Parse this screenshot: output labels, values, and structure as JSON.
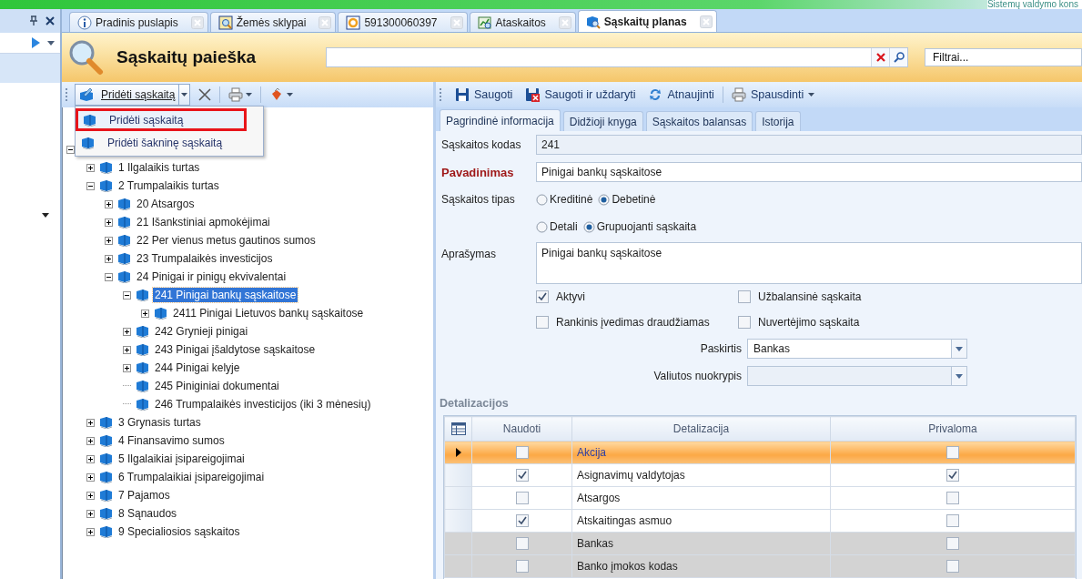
{
  "top_strip": {
    "caption": "Sistemų valdymo kons"
  },
  "document_tabs": [
    {
      "label": "Pradinis puslapis",
      "kind": "info",
      "selected": false
    },
    {
      "label": "Žemės sklypai",
      "kind": "parcel",
      "selected": false
    },
    {
      "label": "591300060397",
      "kind": "parcel-item",
      "selected": false
    },
    {
      "label": "Ataskaitos",
      "kind": "report",
      "selected": false
    },
    {
      "label": "Sąskaitų planas",
      "kind": "accounts",
      "selected": true
    }
  ],
  "header": {
    "title": "Sąskaitų paieška",
    "filter": {
      "placeholder": "Filtrai..."
    }
  },
  "tree_toolbar": {
    "add_button": "Pridėti sąskaitą"
  },
  "add_menu": [
    {
      "label": "Pridėti sąskaitą",
      "selected": true,
      "annotated": true
    },
    {
      "label": "Pridėti šakninę sąskaitą",
      "selected": false,
      "annotated": false
    }
  ],
  "tree": {
    "root_expanded": true,
    "items": [
      {
        "label": "1 Ilgalaikis turtas",
        "expanded": false,
        "selected": false
      },
      {
        "label": "2 Trumpalaikis turtas",
        "expanded": true,
        "selected": false,
        "children": [
          {
            "label": "20 Atsargos",
            "expanded": false,
            "selected": false
          },
          {
            "label": "21 Išankstiniai apmokėjimai",
            "expanded": false,
            "selected": false
          },
          {
            "label": "22 Per vienus metus gautinos sumos",
            "expanded": false,
            "selected": false
          },
          {
            "label": "23 Trumpalaikės investicijos",
            "expanded": false,
            "selected": false
          },
          {
            "label": "24 Pinigai ir pinigų ekvivalentai",
            "expanded": true,
            "selected": false,
            "children": [
              {
                "label": "241 Pinigai bankų sąskaitose",
                "expanded": true,
                "selected": true,
                "children": [
                  {
                    "label": "2411 Pinigai Lietuvos bankų sąskaitose",
                    "expanded": false,
                    "selected": false
                  }
                ]
              },
              {
                "label": "242 Grynieji pinigai",
                "expanded": false,
                "selected": false
              },
              {
                "label": "243 Pinigai įšaldytose sąskaitose",
                "expanded": false,
                "selected": false
              },
              {
                "label": "244 Pinigai kelyje",
                "expanded": false,
                "selected": false
              },
              {
                "label": "245 Piniginiai dokumentai",
                "leaf": true,
                "selected": false
              },
              {
                "label": "246 Trumpalaikės investicijos (iki 3 mėnesių)",
                "leaf": true,
                "selected": false
              }
            ]
          }
        ]
      },
      {
        "label": "3 Grynasis turtas",
        "expanded": false,
        "selected": false
      },
      {
        "label": "4 Finansavimo sumos",
        "expanded": false,
        "selected": false
      },
      {
        "label": "5 Ilgalaikiai įsipareigojimai",
        "expanded": false,
        "selected": false
      },
      {
        "label": "6 Trumpalaikiai įsipareigojimai",
        "expanded": false,
        "selected": false
      },
      {
        "label": "7 Pajamos",
        "expanded": false,
        "selected": false
      },
      {
        "label": "8 Sąnaudos",
        "expanded": false,
        "selected": false
      },
      {
        "label": "9 Specialiosios sąskaitos",
        "expanded": false,
        "selected": false
      }
    ]
  },
  "detail_toolbar": [
    {
      "label": "Saugoti",
      "kind": "save"
    },
    {
      "label": "Saugoti ir uždaryti",
      "kind": "save-close"
    },
    {
      "label": "Atnaujinti",
      "kind": "refresh"
    },
    {
      "label": "Spausdinti",
      "kind": "print"
    }
  ],
  "detail_tabs": [
    {
      "label": "Pagrindinė informacija",
      "selected": true
    },
    {
      "label": "Didžioji knyga",
      "selected": false
    },
    {
      "label": "Sąskaitos balansas",
      "selected": false
    },
    {
      "label": "Istorija",
      "selected": false
    }
  ],
  "form": {
    "code": {
      "label": "Sąskaitos kodas",
      "value": "241"
    },
    "name": {
      "label": "Pavadinimas",
      "value": "Pinigai bankų sąskaitose"
    },
    "type": {
      "label": "Sąskaitos tipas",
      "options": [
        {
          "label": "Kreditinė",
          "selected": false
        },
        {
          "label": "Debetinė",
          "selected": true
        }
      ]
    },
    "grouping": {
      "options": [
        {
          "label": "Detali",
          "selected": false
        },
        {
          "label": "Grupuojanti sąskaita",
          "selected": true
        }
      ]
    },
    "description": {
      "label": "Aprašymas",
      "value": "Pinigai bankų sąskaitose"
    },
    "checkboxes": [
      {
        "label": "Aktyvi",
        "checked": true
      },
      {
        "label": "Užbalansinė sąskaita",
        "checked": false
      },
      {
        "label": "Rankinis įvedimas draudžiamas",
        "checked": false
      },
      {
        "label": "Nuvertėjimo sąskaita",
        "checked": false
      }
    ],
    "purpose": {
      "label": "Paskirtis",
      "value": "Bankas"
    },
    "currency": {
      "label": "Valiutos nuokrypis"
    }
  },
  "details": {
    "title": "Detalizacijos",
    "columns": [
      "Naudoti",
      "Detalizacija",
      "Privaloma"
    ],
    "rows": [
      {
        "use": false,
        "name": "Akcija",
        "required": false,
        "selected": true,
        "disabled": false
      },
      {
        "use": true,
        "name": "Asignavimų valdytojas",
        "required": true,
        "selected": false,
        "disabled": false
      },
      {
        "use": false,
        "name": "Atsargos",
        "required": false,
        "selected": false,
        "disabled": false
      },
      {
        "use": true,
        "name": "Atskaitingas asmuo",
        "required": false,
        "selected": false,
        "disabled": false
      },
      {
        "use": false,
        "name": "Bankas",
        "required": false,
        "selected": false,
        "disabled": true
      },
      {
        "use": false,
        "name": "Banko įmokos kodas",
        "required": false,
        "selected": false,
        "disabled": true
      }
    ]
  }
}
